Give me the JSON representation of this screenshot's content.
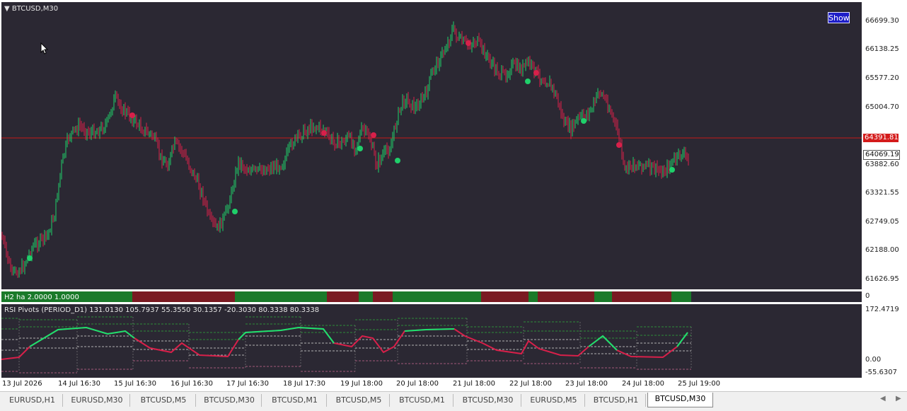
{
  "chart": {
    "symbol_label": "BTCUSD,M30",
    "show_button": "Show",
    "bid_price": "64391.81",
    "last_price": "64069.19",
    "price_scale": [
      "66699.30",
      "66138.25",
      "65577.20",
      "65004.70",
      "63882.60",
      "63321.55",
      "62749.05",
      "62188.00",
      "61626.95"
    ],
    "colors": {
      "background": "#2b2833",
      "bull": "#1fcf6a",
      "bear": "#d8204a",
      "bid_line": "#c41a1a"
    }
  },
  "ha_indicator": {
    "label": "H2  ha  2.0000 1.0000",
    "scale_value": "0",
    "colors": {
      "bull": "#1a7a2a",
      "bear": "#7a1a22"
    }
  },
  "rsi_indicator": {
    "label": "RSI Pivots (PERIOD_D1) 131.0130 105.7937 55.3550 30.1357 -20.3030 80.3338 80.3338",
    "scale": [
      "172.4719",
      "0.00",
      "-55.6307"
    ]
  },
  "time_axis": [
    "13 Jul 2026",
    "14 Jul 16:30",
    "15 Jul 16:30",
    "16 Jul 16:30",
    "17 Jul 16:30",
    "18 Jul 17:30",
    "19 Jul 18:00",
    "20 Jul 18:00",
    "21 Jul 18:00",
    "22 Jul 18:00",
    "23 Jul 18:00",
    "24 Jul 18:00",
    "25 Jul 19:00"
  ],
  "tabs": [
    "EURUSD,H1",
    "EURUSD,M30",
    "BTCUSD,M5",
    "BTCUSD,M30",
    "BTCUSD,M1",
    "BTCUSD,M5",
    "BTCUSD,M1",
    "BTCUSD,M30",
    "EURUSD,M5",
    "BTCUSD,H1",
    "BTCUSD,M30"
  ],
  "active_tab": 10
}
